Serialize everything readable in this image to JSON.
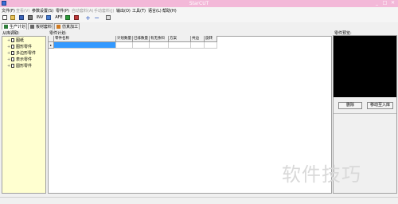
{
  "window": {
    "title": "StarCUT",
    "minimize": "_",
    "maximize": "□",
    "close": "✕"
  },
  "menu": [
    {
      "label": "文件(F)",
      "enabled": true
    },
    {
      "label": "查看(V)",
      "enabled": false
    },
    {
      "label": "参数设置(S)",
      "enabled": true
    },
    {
      "label": "零件(P)",
      "enabled": true
    },
    {
      "label": "自动套料(A)",
      "enabled": false
    },
    {
      "label": "手动套料(J)",
      "enabled": false
    },
    {
      "label": "输出(O)",
      "enabled": true
    },
    {
      "label": "工具(T)",
      "enabled": true
    },
    {
      "label": "语言(L)",
      "enabled": true
    },
    {
      "label": "帮助(H)",
      "enabled": true
    }
  ],
  "toolbar": {
    "inv": "INV",
    "afe": "AFE",
    "plus": "+",
    "minus": "−"
  },
  "tabs": [
    {
      "label": "生产计划",
      "active": true
    },
    {
      "label": "板材套料",
      "active": false
    },
    {
      "label": "仿真加工",
      "active": false
    }
  ],
  "left_panel": {
    "title": "从库调取:",
    "items": [
      "图纸",
      "图形零件",
      "多边形零件",
      "表示零件",
      "圆形零件"
    ]
  },
  "table": {
    "title": "零件计划:",
    "columns": [
      "零件名称",
      "计划数量",
      "已排数量",
      "有无余料",
      "方案",
      "共边",
      "旋转"
    ]
  },
  "right_panel": {
    "title": "零件预览:",
    "delete_label": "删除",
    "move_label": "移动至入库"
  },
  "watermark": "软件技巧",
  "colors": {
    "titlebar": "#f3b8d8",
    "selection": "#3399ff"
  }
}
